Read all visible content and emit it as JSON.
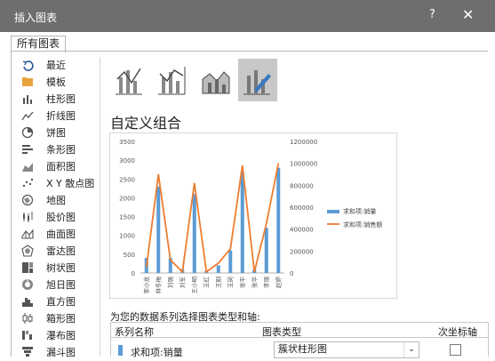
{
  "dialog": {
    "title": "插入图表",
    "help": "?",
    "close": "✕"
  },
  "tab": {
    "label": "所有图表"
  },
  "nav": {
    "items": [
      {
        "label": "最近",
        "icon": "recent-icon"
      },
      {
        "label": "模板",
        "icon": "template-folder-icon"
      },
      {
        "label": "柱形图",
        "icon": "column-chart-icon"
      },
      {
        "label": "折线图",
        "icon": "line-chart-icon"
      },
      {
        "label": "饼图",
        "icon": "pie-chart-icon"
      },
      {
        "label": "条形图",
        "icon": "bar-chart-icon"
      },
      {
        "label": "面积图",
        "icon": "area-chart-icon"
      },
      {
        "label": "X Y 散点图",
        "icon": "scatter-chart-icon"
      },
      {
        "label": "地图",
        "icon": "map-chart-icon"
      },
      {
        "label": "股价图",
        "icon": "stock-chart-icon"
      },
      {
        "label": "曲面图",
        "icon": "surface-chart-icon"
      },
      {
        "label": "雷达图",
        "icon": "radar-chart-icon"
      },
      {
        "label": "树状图",
        "icon": "treemap-chart-icon"
      },
      {
        "label": "旭日图",
        "icon": "sunburst-chart-icon"
      },
      {
        "label": "直方图",
        "icon": "histogram-chart-icon"
      },
      {
        "label": "箱形图",
        "icon": "box-whisker-chart-icon"
      },
      {
        "label": "瀑布图",
        "icon": "waterfall-chart-icon"
      },
      {
        "label": "漏斗图",
        "icon": "funnel-chart-icon"
      }
    ]
  },
  "combo_types": [
    "clustered-column-line-icon",
    "clustered-column-line-secondary-icon",
    "stacked-area-column-icon",
    "custom-combo-icon"
  ],
  "main": {
    "heading": "自定义组合"
  },
  "series_section": {
    "prompt": "为您的数据系列选择图表类型和轴:",
    "col_name": "系列名称",
    "col_type": "图表类型",
    "col_axis": "次坐标轴",
    "row": {
      "name": "求和项:销量",
      "type": "簇状柱形图",
      "dropdown": "⌄"
    }
  },
  "colors": {
    "bar": "#5b9bd5",
    "line": "#ed7d31",
    "titlebar": "#6e6e6e",
    "selected": "#c8c8c8"
  },
  "chart_data": {
    "type": "bar",
    "categories": [
      "李小龙",
      "林冬梅",
      "刘强",
      "刘军",
      "王小明",
      "王红",
      "王刚",
      "王珂",
      "张平",
      "张华",
      "李丽",
      "赵婷"
    ],
    "y_left_ticks": [
      0,
      500,
      1000,
      1500,
      2000,
      2500,
      3000,
      3500
    ],
    "y_right_ticks": [
      0,
      200000,
      400000,
      600000,
      800000,
      1000000,
      1200000
    ],
    "ylim_left": [
      0,
      3500
    ],
    "ylim_right": [
      0,
      1200000
    ],
    "series": [
      {
        "name": "求和项:销量",
        "type": "bar",
        "axis": "left",
        "values": [
          400,
          2300,
          400,
          100,
          2100,
          50,
          200,
          600,
          2700,
          100,
          1200,
          2800
        ]
      },
      {
        "name": "求和项:销售额",
        "type": "line",
        "axis": "right",
        "values": [
          50000,
          900000,
          120000,
          10000,
          820000,
          10000,
          90000,
          220000,
          980000,
          10000,
          450000,
          1000000
        ]
      }
    ],
    "legend_position": "right"
  }
}
